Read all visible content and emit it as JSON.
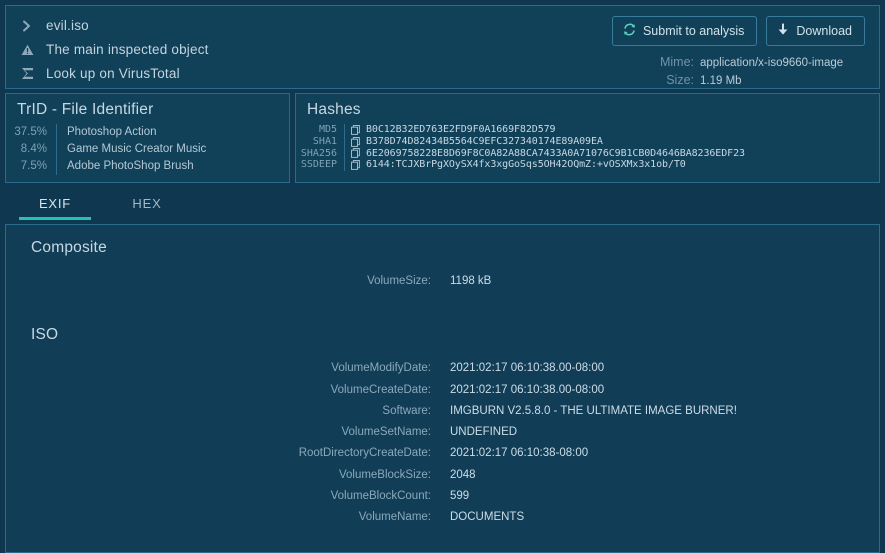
{
  "header": {
    "rows": [
      {
        "icon": "chevron-right-icon",
        "label": "evil.iso"
      },
      {
        "icon": "warning-triangle-icon",
        "label": "The main inspected object"
      },
      {
        "icon": "virustotal-icon",
        "label": "Look up on VirusTotal"
      }
    ],
    "buttons": [
      {
        "icon": "refresh-icon",
        "label": "Submit to analysis"
      },
      {
        "icon": "download-icon",
        "label": "Download"
      }
    ],
    "meta": [
      {
        "label": "Mime:",
        "value": "application/x-iso9660-image"
      },
      {
        "label": "Size:",
        "value": "1.19 Mb"
      }
    ]
  },
  "trid": {
    "title": "TrID - File Identifier",
    "rows": [
      {
        "percent": "37.5%",
        "name": "Photoshop Action"
      },
      {
        "percent": "8.4%",
        "name": "Game Music Creator Music"
      },
      {
        "percent": "7.5%",
        "name": "Adobe PhotoShop Brush"
      }
    ]
  },
  "hashes": {
    "title": "Hashes",
    "rows": [
      {
        "label": "MD5",
        "value": "B0C12B32ED763E2FD9F0A1669F82D579"
      },
      {
        "label": "SHA1",
        "value": "B378D74D82434B5564C9EFC327340174E89A09EA"
      },
      {
        "label": "SHA256",
        "value": "6E2069758228E8D69F8C0A82A88CA7433A0A71076C9B1CB0D4646BA8236EDF23"
      },
      {
        "label": "SSDEEP",
        "value": "6144:TCJXBrPgXOySX4fx3xgGoSqs5OH42OQmZ:+vOSXMx3x1ob/T0"
      }
    ]
  },
  "tabs": [
    {
      "label": "EXIF",
      "active": true
    },
    {
      "label": "HEX",
      "active": false
    }
  ],
  "exif": {
    "sections": [
      {
        "title": "Composite",
        "rows": [
          {
            "key": "VolumeSize:",
            "value": "1198 kB"
          }
        ]
      },
      {
        "title": "ISO",
        "rows": [
          {
            "key": "VolumeModifyDate:",
            "value": "2021:02:17 06:10:38.00-08:00"
          },
          {
            "key": "VolumeCreateDate:",
            "value": "2021:02:17 06:10:38.00-08:00"
          },
          {
            "key": "Software:",
            "value": "IMGBURN V2.5.8.0 - THE ULTIMATE IMAGE BURNER!"
          },
          {
            "key": "VolumeSetName:",
            "value": "UNDEFINED"
          },
          {
            "key": "RootDirectoryCreateDate:",
            "value": "2021:02:17 06:10:38-08:00"
          },
          {
            "key": "VolumeBlockSize:",
            "value": "2048"
          },
          {
            "key": "VolumeBlockCount:",
            "value": "599"
          },
          {
            "key": "VolumeName:",
            "value": "DOCUMENTS"
          }
        ]
      }
    ]
  },
  "colors": {
    "background": "#0f3850",
    "panel": "#114059",
    "border": "#2a6a8a",
    "accent": "#1fc4b4",
    "text": "#c6d8e2",
    "muted": "#7ea2b5"
  }
}
